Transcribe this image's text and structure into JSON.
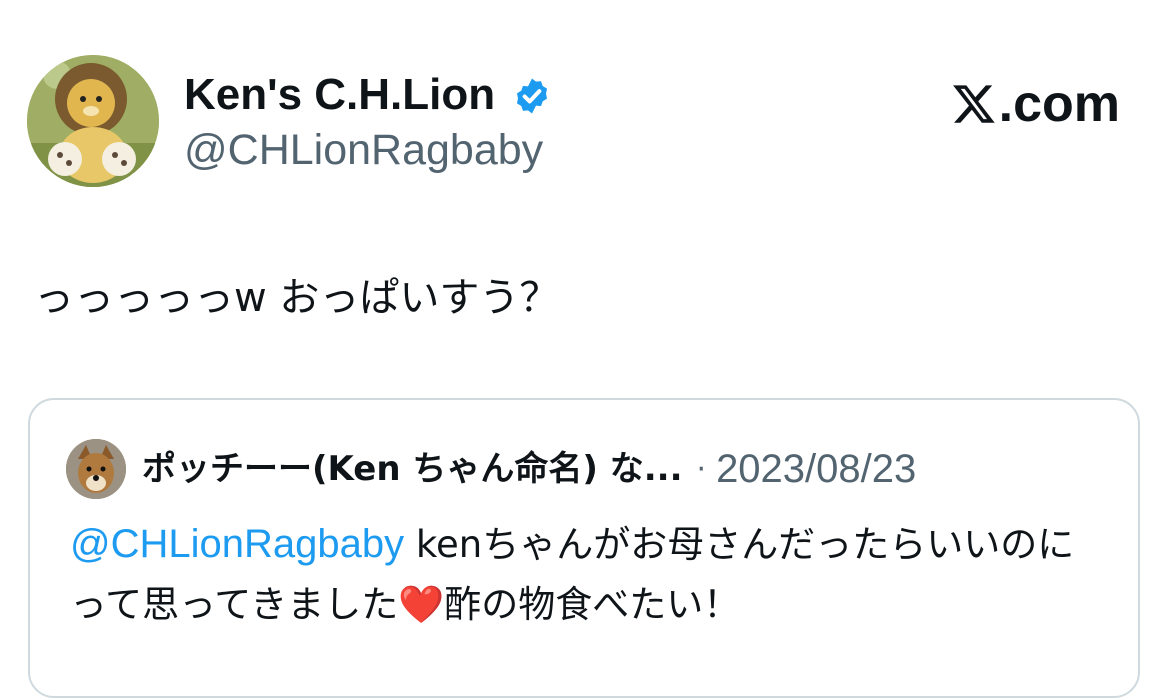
{
  "author": {
    "display_name": "Ken's C.H.Lion",
    "handle": "@CHLionRagbaby",
    "verified": true,
    "avatar_icon": "lion-plush-avatar"
  },
  "site": {
    "domain": ".com",
    "logo_icon": "x-logo-icon"
  },
  "post": {
    "text": "っっっっっw おっぱいすう？"
  },
  "quoted_post": {
    "author_name": "ポッチーー(Ken ちゃん命名) な...",
    "separator": "·",
    "date": "2023/08/23",
    "mention": "@CHLionRagbaby",
    "text_before_emoji": " kenちゃんがお母さんだったらいいのにって思ってきました",
    "emoji": "❤️",
    "text_after_emoji": "酢の物食べたい！",
    "avatar_icon": "dog-avatar"
  },
  "colors": {
    "text_primary": "#0f1419",
    "text_secondary": "#536471",
    "link": "#1d9bf0",
    "verified_badge": "#1d9bf0",
    "card_border": "#cfd9de"
  }
}
